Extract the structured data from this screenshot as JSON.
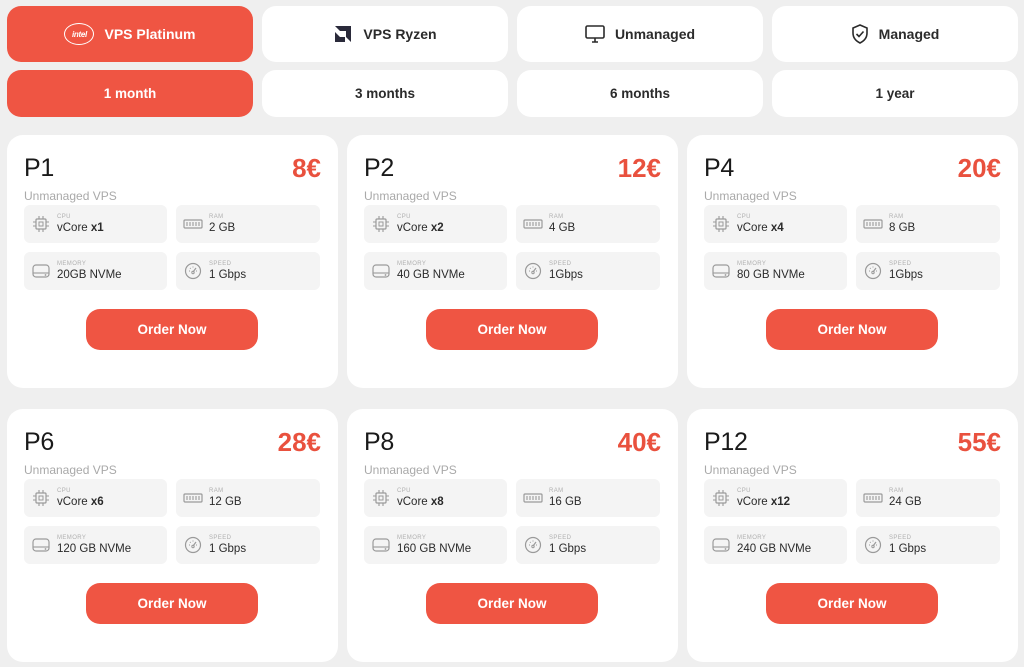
{
  "tabs_row1": [
    {
      "label": "VPS Platinum",
      "icon": "intel-icon",
      "active": true,
      "logo_text": "intel"
    },
    {
      "label": "VPS Ryzen",
      "icon": "amd-icon",
      "active": false
    },
    {
      "label": "Unmanaged",
      "icon": "monitor-icon",
      "active": false
    },
    {
      "label": "Managed",
      "icon": "shield-check-icon",
      "active": false
    }
  ],
  "tabs_row2": [
    {
      "label": "1 month",
      "active": true
    },
    {
      "label": "3 months",
      "active": false
    },
    {
      "label": "6 months",
      "active": false
    },
    {
      "label": "1 year",
      "active": false
    }
  ],
  "spec_labels": {
    "cpu": "CPU",
    "ram": "RAM",
    "memory": "MEMORY",
    "speed": "SPEED"
  },
  "order_label": "Order Now",
  "plans": [
    {
      "name": "P1",
      "price": "8€",
      "subtitle": "Unmanaged VPS",
      "cpu_prefix": "vCore ",
      "cpu_count": "x1",
      "ram": "2 GB",
      "memory": "20GB NVMe",
      "speed": "1 Gbps"
    },
    {
      "name": "P2",
      "price": "12€",
      "subtitle": "Unmanaged VPS",
      "cpu_prefix": "vCore ",
      "cpu_count": "x2",
      "ram": "4 GB",
      "memory": "40 GB NVMe",
      "speed": "1Gbps"
    },
    {
      "name": "P4",
      "price": "20€",
      "subtitle": "Unmanaged VPS",
      "cpu_prefix": "vCore ",
      "cpu_count": "x4",
      "ram": "8 GB",
      "memory": "80 GB NVMe",
      "speed": "1Gbps"
    },
    {
      "name": "P6",
      "price": "28€",
      "subtitle": "Unmanaged VPS",
      "cpu_prefix": "vCore ",
      "cpu_count": "x6",
      "ram": "12 GB",
      "memory": "120 GB NVMe",
      "speed": "1 Gbps"
    },
    {
      "name": "P8",
      "price": "40€",
      "subtitle": "Unmanaged VPS",
      "cpu_prefix": "vCore ",
      "cpu_count": "x8",
      "ram": "16 GB",
      "memory": "160 GB NVMe",
      "speed": "1 Gbps"
    },
    {
      "name": "P12",
      "price": "55€",
      "subtitle": "Unmanaged VPS",
      "cpu_prefix": "vCore ",
      "cpu_count": "x12",
      "ram": "24 GB",
      "memory": "240 GB NVMe",
      "speed": "1 Gbps"
    }
  ],
  "colors": {
    "accent": "#ef5543",
    "price": "#e9513e",
    "background": "#efefef"
  }
}
